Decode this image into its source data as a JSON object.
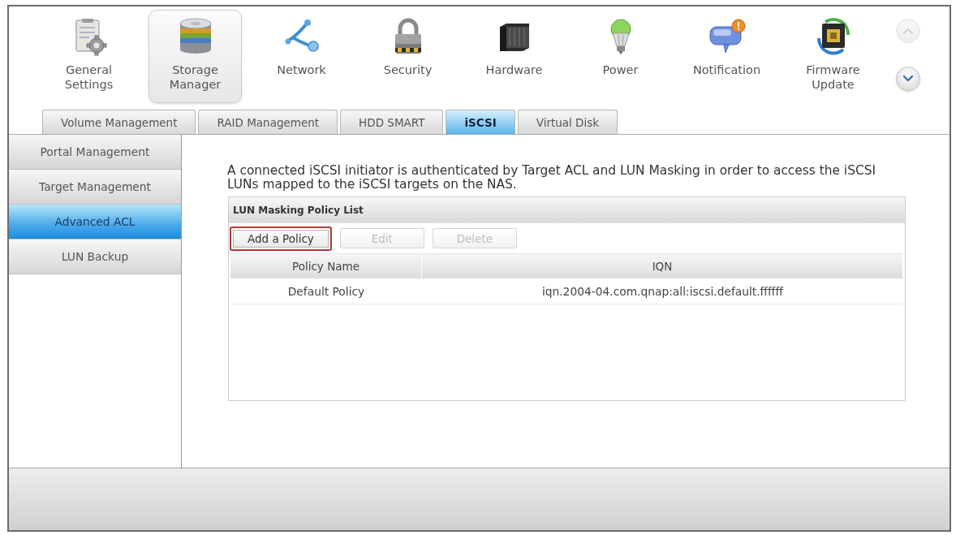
{
  "toolbar": {
    "items": [
      {
        "label": "General Settings",
        "selected": false
      },
      {
        "label": "Storage Manager",
        "selected": true
      },
      {
        "label": "Network",
        "selected": false
      },
      {
        "label": "Security",
        "selected": false
      },
      {
        "label": "Hardware",
        "selected": false
      },
      {
        "label": "Power",
        "selected": false
      },
      {
        "label": "Notification",
        "selected": false
      },
      {
        "label": "Firmware Update",
        "selected": false
      }
    ],
    "scroll_buttons": [
      {
        "kind": "up",
        "disabled": true
      },
      {
        "kind": "down",
        "disabled": false
      }
    ]
  },
  "tabs": [
    {
      "label": "Volume Management",
      "selected": false
    },
    {
      "label": "RAID Management",
      "selected": false
    },
    {
      "label": "HDD SMART",
      "selected": false
    },
    {
      "label": "iSCSI",
      "selected": true
    },
    {
      "label": "Virtual Disk",
      "selected": false
    }
  ],
  "sidebar": {
    "items": [
      {
        "label": "Portal Management",
        "selected": false
      },
      {
        "label": "Target Management",
        "selected": false
      },
      {
        "label": "Advanced ACL",
        "selected": true
      },
      {
        "label": "LUN Backup",
        "selected": false
      }
    ]
  },
  "content": {
    "description": "A connected iSCSI initiator is authenticated by Target ACL and LUN Masking in order to access the iSCSI LUNs mapped to the iSCSI targets on the NAS.",
    "policy_panel": {
      "title": "LUN Masking Policy List",
      "buttons": [
        {
          "label": "Add a Policy",
          "disabled": false,
          "highlighted": true
        },
        {
          "label": "Edit",
          "disabled": true,
          "highlighted": false
        },
        {
          "label": "Delete",
          "disabled": true,
          "highlighted": false
        }
      ],
      "table": {
        "columns": [
          "Policy Name",
          "IQN"
        ],
        "rows": [
          [
            "Default Policy",
            "iqn.2004-04.com.qnap:all:iscsi.default.ffffff"
          ]
        ]
      }
    }
  }
}
